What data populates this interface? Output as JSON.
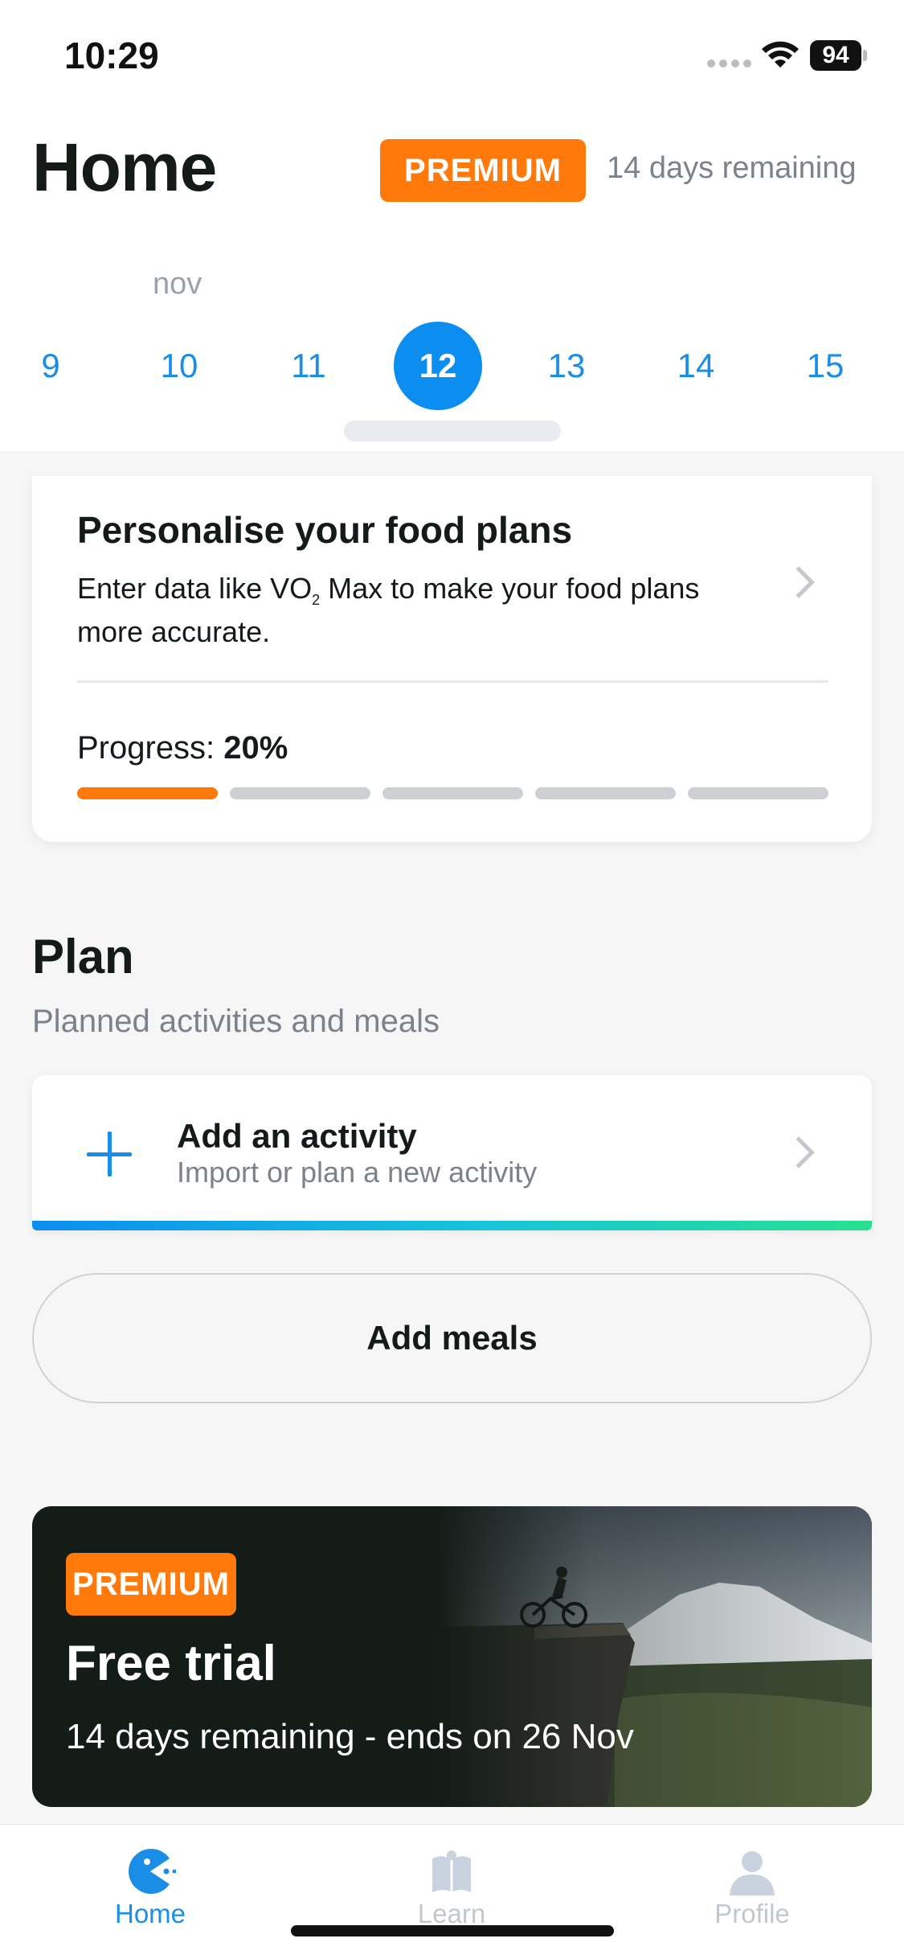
{
  "status_bar": {
    "time": "10:29",
    "battery": "94"
  },
  "header": {
    "title": "Home",
    "premium_badge": "PREMIUM",
    "days_remaining": "14 days remaining"
  },
  "calendar": {
    "month": "nov",
    "days": [
      "9",
      "10",
      "11",
      "12",
      "13",
      "14",
      "15"
    ],
    "selected": "12"
  },
  "personalise_card": {
    "title": "Personalise your food plans",
    "description_part1": "Enter data like VO",
    "description_sub": "2",
    "description_part2": " Max to make your food plans more accurate.",
    "progress_label": "Progress:",
    "progress_value": "20%",
    "progress_fraction": 0.2,
    "progress_segments": 5,
    "progress_filled": 1
  },
  "plan": {
    "title": "Plan",
    "subtitle": "Planned activities and meals",
    "add_activity_title": "Add an activity",
    "add_activity_subtitle": "Import or plan a new activity",
    "add_meals_label": "Add meals"
  },
  "trial_banner": {
    "badge": "PREMIUM",
    "title": "Free trial",
    "subtitle": "14 days remaining - ends on 26 Nov"
  },
  "tab_bar": {
    "items": [
      {
        "label": "Home",
        "icon": "home-pacman-icon",
        "active": true
      },
      {
        "label": "Learn",
        "icon": "book-icon",
        "active": false
      },
      {
        "label": "Profile",
        "icon": "person-icon",
        "active": false
      }
    ]
  },
  "colors": {
    "accent_blue": "#0b8ef0",
    "premium_orange": "#ff7a0a",
    "text_dark": "#141b17",
    "text_muted": "#7b828b"
  }
}
